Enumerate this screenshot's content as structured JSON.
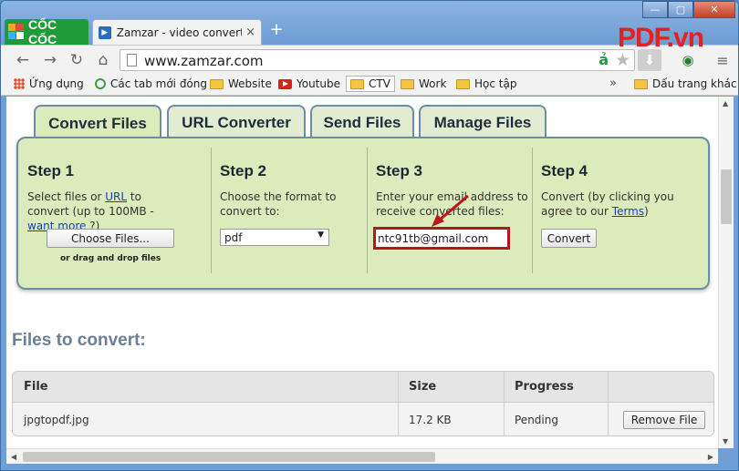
{
  "browser": {
    "logo_text": "CỐC CỐC",
    "tab_title": "Zamzar - video converter, a",
    "tab_close": "×",
    "new_tab": "+",
    "url": "www.zamzar.com",
    "omnibox_badge": "ả",
    "watermark": "PDF.vn",
    "controls": {
      "minimize": "—",
      "maximize": "▢",
      "close": "✕"
    }
  },
  "bookmarks": {
    "items": [
      {
        "label": "Ứng dụng",
        "icon": "apps-icon"
      },
      {
        "label": "Các tab mới đóng",
        "icon": "recent-tabs-icon"
      },
      {
        "label": "Website",
        "icon": "folder-icon"
      },
      {
        "label": "Youtube",
        "icon": "youtube-icon"
      },
      {
        "label": "CTV",
        "icon": "folder-icon"
      },
      {
        "label": "Work",
        "icon": "folder-icon"
      },
      {
        "label": "Học tập",
        "icon": "folder-icon"
      }
    ],
    "more": "»",
    "other_bookmarks": "Dấu trang khác"
  },
  "tabs": [
    {
      "label": "Convert Files",
      "active": true
    },
    {
      "label": "URL Converter",
      "active": false
    },
    {
      "label": "Send Files",
      "active": false
    },
    {
      "label": "Manage Files",
      "active": false
    }
  ],
  "steps": {
    "step1": {
      "title": "Step 1",
      "desc_pre": "Select files or ",
      "desc_link1": "URL",
      "desc_mid": " to convert (up to 100MB - ",
      "desc_link2": "want more",
      "desc_post": " ?)",
      "button": "Choose Files...",
      "note": "or drag and drop files"
    },
    "step2": {
      "title": "Step 2",
      "desc": "Choose the format to convert to:",
      "selected_format": "pdf",
      "caret": "▼"
    },
    "step3": {
      "title": "Step 3",
      "desc": "Enter your email address to receive converted files:",
      "email": "ntc91tb@gmail.com"
    },
    "step4": {
      "title": "Step 4",
      "desc_pre": "Convert (by clicking you agree to our ",
      "desc_link": "Terms",
      "desc_post": ")",
      "button": "Convert"
    }
  },
  "files": {
    "title": "Files to convert:",
    "columns": [
      "File",
      "Size",
      "Progress"
    ],
    "rows": [
      {
        "file": "jpgtopdf.jpg",
        "size": "17.2 KB",
        "progress": "Pending",
        "action": "Remove File"
      }
    ]
  },
  "colors": {
    "panel_bg": "#dcebbb",
    "panel_border": "#6d8ca8",
    "highlight": "#b3161b",
    "link": "#1a3cc4"
  }
}
